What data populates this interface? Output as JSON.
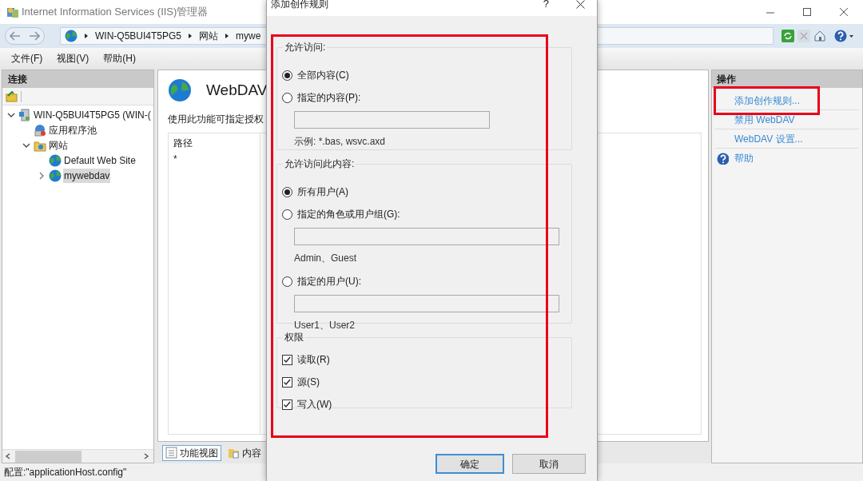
{
  "window": {
    "title": "Internet Information Services (IIS)管理器"
  },
  "address_bar": {
    "crumbs": [
      "WIN-Q5BUI4T5PG5",
      "网站",
      "mywe"
    ]
  },
  "menu": [
    "文件(F)",
    "视图(V)",
    "帮助(H)"
  ],
  "connections": {
    "title": "连接",
    "tree": [
      {
        "label": "WIN-Q5BUI4T5PG5 (WIN-(",
        "kind": "server",
        "expanded": true,
        "selected": false,
        "children": [
          {
            "label": "应用程序池",
            "kind": "pool",
            "selected": false
          },
          {
            "label": "网站",
            "kind": "folder",
            "expanded": true,
            "selected": false,
            "children": [
              {
                "label": "Default Web Site",
                "kind": "site",
                "selected": false
              },
              {
                "label": "mywebdav",
                "kind": "site",
                "expanded": false,
                "selected": true
              }
            ]
          }
        ]
      }
    ]
  },
  "feature": {
    "title": "WebDAV",
    "description": "使用此功能可指定授权",
    "table": {
      "columns": [
        "路径"
      ],
      "rows": [
        [
          "*"
        ]
      ]
    }
  },
  "view_tabs": [
    {
      "label": "功能视图",
      "selected": true
    },
    {
      "label": "内容",
      "selected": false
    }
  ],
  "actions": {
    "title": "操作",
    "items": [
      {
        "label": "添加创作规则...",
        "kind": "link"
      },
      {
        "label": "禁用 WebDAV",
        "kind": "link"
      },
      {
        "label": "WebDAV 设置...",
        "kind": "link"
      },
      {
        "label": "帮助",
        "kind": "help"
      }
    ]
  },
  "status_bar": "配置:\"applicationHost.config\"",
  "dialog": {
    "title": "添加创作规则",
    "help": "?",
    "groups": [
      {
        "title": "允许访问:",
        "items": [
          {
            "kind": "radio",
            "label": "全部内容(C)",
            "selected": true
          },
          {
            "kind": "radio",
            "label": "指定的内容(P):",
            "selected": false
          },
          {
            "kind": "field"
          },
          {
            "kind": "hint",
            "label": "示例: *.bas, wsvc.axd"
          }
        ]
      },
      {
        "title": "允许访问此内容:",
        "items": [
          {
            "kind": "radio",
            "label": "所有用户(A)",
            "selected": true
          },
          {
            "kind": "radio",
            "label": "指定的角色或用户组(G):",
            "selected": false
          },
          {
            "kind": "field"
          },
          {
            "kind": "hint",
            "label": "Admin、Guest"
          },
          {
            "kind": "radio",
            "label": "指定的用户(U):",
            "selected": false
          },
          {
            "kind": "field"
          },
          {
            "kind": "hint",
            "label": "User1、User2"
          }
        ]
      },
      {
        "title": "权限",
        "items": [
          {
            "kind": "checkbox",
            "label": "读取(R)",
            "checked": true
          },
          {
            "kind": "checkbox",
            "label": "源(S)",
            "checked": true
          },
          {
            "kind": "checkbox",
            "label": "写入(W)",
            "checked": true
          }
        ]
      }
    ],
    "buttons": [
      {
        "label": "确定",
        "default": true
      },
      {
        "label": "取消",
        "default": false
      }
    ]
  }
}
